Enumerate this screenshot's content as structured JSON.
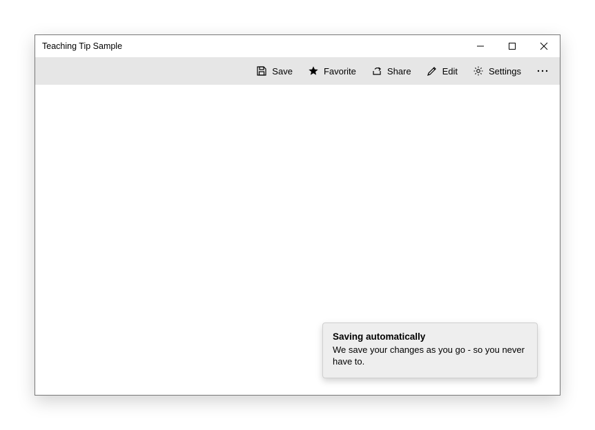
{
  "window": {
    "title": "Teaching Tip Sample"
  },
  "commands": {
    "save": "Save",
    "favorite": "Favorite",
    "share": "Share",
    "edit": "Edit",
    "settings": "Settings"
  },
  "teaching_tip": {
    "title": "Saving automatically",
    "body": "We save your changes as you go - so you never have to."
  }
}
